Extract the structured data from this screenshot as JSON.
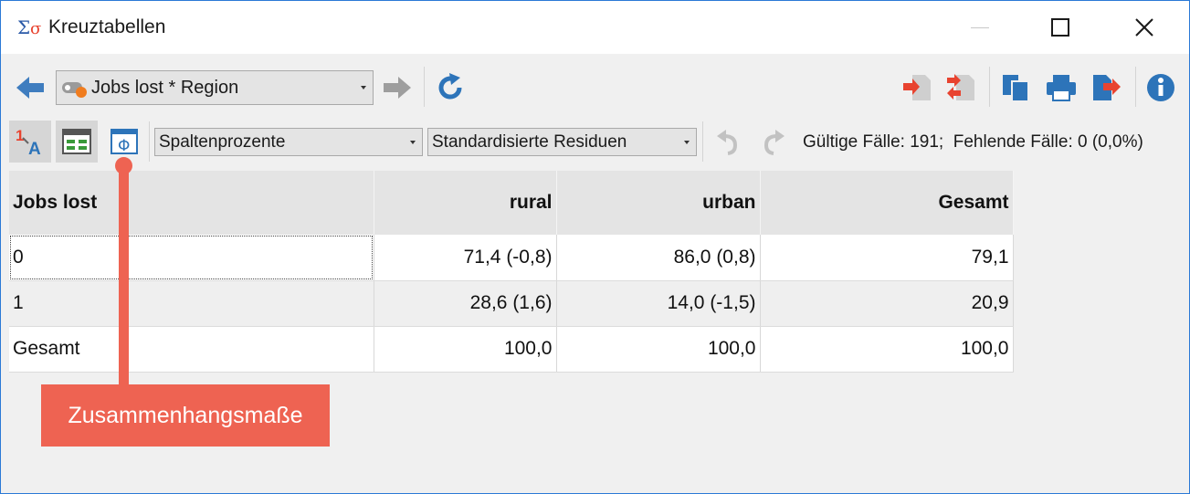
{
  "window": {
    "title": "Kreuztabellen",
    "app_icon": "sigma-sigma-icon"
  },
  "toolbar1": {
    "variable_combo": "Jobs lost * Region",
    "icons": [
      "arrow-left-icon",
      "arrow-right-icon",
      "refresh-icon",
      "export-in-icon",
      "export-transfer-icon",
      "copy-icon",
      "print-icon",
      "export-out-icon",
      "info-icon"
    ]
  },
  "toolbar2": {
    "percent_combo": "Spaltenprozente",
    "residual_combo": "Standardisierte Residuen",
    "cases": "Gültige Fälle: 191;  Fehlende Fälle: 0 (0,0%)"
  },
  "table": {
    "headers": [
      "Jobs lost",
      "rural",
      "urban",
      "Gesamt"
    ],
    "rows": [
      [
        "0",
        "71,4 (-0,8)",
        "86,0 (0,8)",
        "79,1"
      ],
      [
        "1",
        "28,6 (1,6)",
        "14,0 (-1,5)",
        "20,9"
      ],
      [
        "Gesamt",
        "100,0",
        "100,0",
        "100,0"
      ]
    ]
  },
  "callout": {
    "label": "Zusammenhangsmaße"
  },
  "colors": {
    "accent_blue": "#2b79d6",
    "callout": "#ee6352",
    "export_red": "#e8432f",
    "icon_gray": "#c8c8c8"
  }
}
